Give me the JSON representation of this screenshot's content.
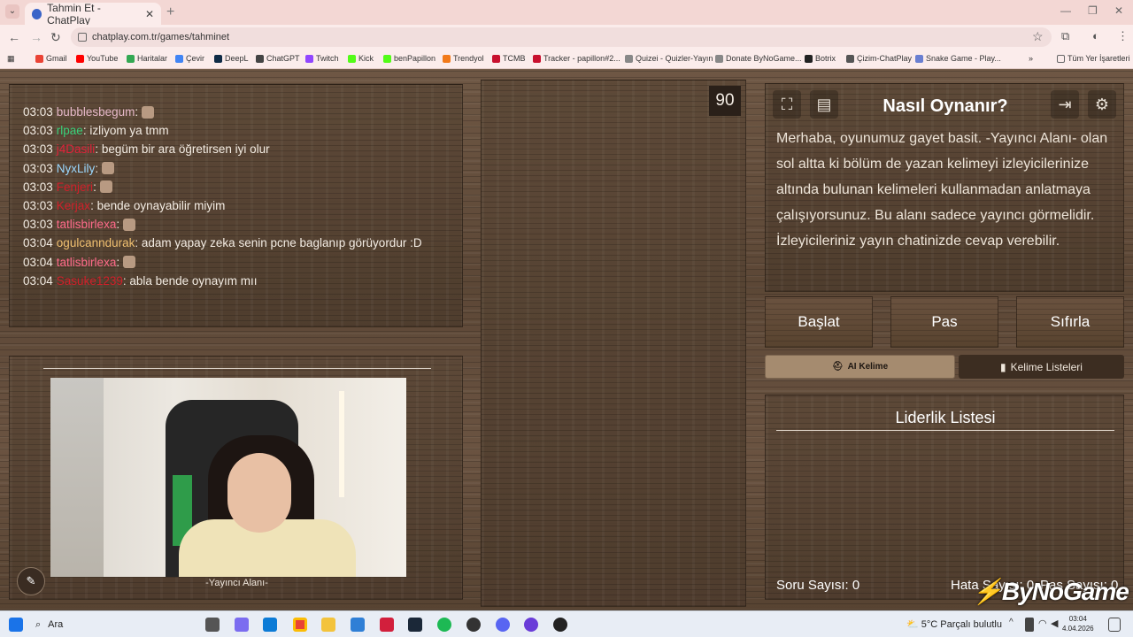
{
  "browser": {
    "tab_title": "Tahmin Et - ChatPlay",
    "url": "chatplay.com.tr/games/tahminet",
    "bookmarks": [
      "Gmail",
      "YouTube",
      "Haritalar",
      "Çevir",
      "DeepL",
      "ChatGPT",
      "Twitch",
      "Kick",
      "benPapillon",
      "Trendyol",
      "TCMB",
      "Tracker - papillon#2...",
      "Quizei - Quizler-Yayın",
      "Donate ByNoGame...",
      "Botrix",
      "Çizim-ChatPlay",
      "Snake Game - Play..."
    ],
    "all_bookmarks": "Tüm Yer İşaretleri"
  },
  "chat": {
    "messages": [
      {
        "time": "03:03",
        "user": "bubblesbegum",
        "user_color": "#e6b8c8",
        "text": ":",
        "emote": true
      },
      {
        "time": "03:03",
        "user": "rlpae",
        "user_color": "#39d07a",
        "text": ": izliyom ya tmm",
        "emote": false
      },
      {
        "time": "03:03",
        "user": "j4Dasili",
        "user_color": "#e0223a",
        "text": ": begüm bir ara öğretirsen iyi olur",
        "emote": false
      },
      {
        "time": "03:03",
        "user": "NyxLily",
        "user_color": "#9ad8ff",
        "text": ":",
        "emote": true
      },
      {
        "time": "03:03",
        "user": "Fenjeri",
        "user_color": "#d0202a",
        "text": ":",
        "emote": true
      },
      {
        "time": "03:03",
        "user": "Kerjax",
        "user_color": "#d0202a",
        "text": ": bende oynayabilir miyim",
        "emote": false
      },
      {
        "time": "03:03",
        "user": "tatlisbirlexa",
        "user_color": "#ff6a8a",
        "text": ":",
        "emote": true
      },
      {
        "time": "03:04",
        "user": "ogulcanndurak",
        "user_color": "#f0c070",
        "text": ": adam yapay zeka senin pcne baglanıp görüyordur :D",
        "emote": false
      },
      {
        "time": "03:04",
        "user": "tatlisbirlexa",
        "user_color": "#ff6a8a",
        "text": ":",
        "emote": true
      },
      {
        "time": "03:04",
        "user": "Sasuke1239",
        "user_color": "#d0202a",
        "text": ": abla bende oynayım mıı",
        "emote": false
      }
    ]
  },
  "streamer": {
    "caption": "-Yayıncı Alanı-"
  },
  "timer": "90",
  "howto": {
    "title": "Nasıl Oynanır?",
    "text": "Merhaba, oyunumuz gayet basit. -Yayıncı Alanı- olan sol altta ki bölüm de yazan kelimeyi izleyicilerinize altında bulunan kelimeleri kullanmadan anlatmaya çalışıyorsunuz. Bu alanı sadece yayıncı görmelidir. İzleyicileriniz yayın chatinizde cevap verebilir."
  },
  "actions": {
    "start": "Başlat",
    "pass": "Pas",
    "reset": "Sıfırla"
  },
  "tabs": {
    "ai": "AI Kelime",
    "lists": "Kelime Listeleri"
  },
  "leaderboard": {
    "title": "Liderlik Listesi",
    "question_count": "Soru Sayısı: 0",
    "error_count": "Hata Sayısı: 0",
    "pass_count": "Pas Sayısı: 0"
  },
  "logo": "ByNoGame",
  "taskbar": {
    "search": "Ara",
    "weather": "5°C  Parçalı bulutlu",
    "time": "03:04",
    "date": "4.04.2026"
  }
}
